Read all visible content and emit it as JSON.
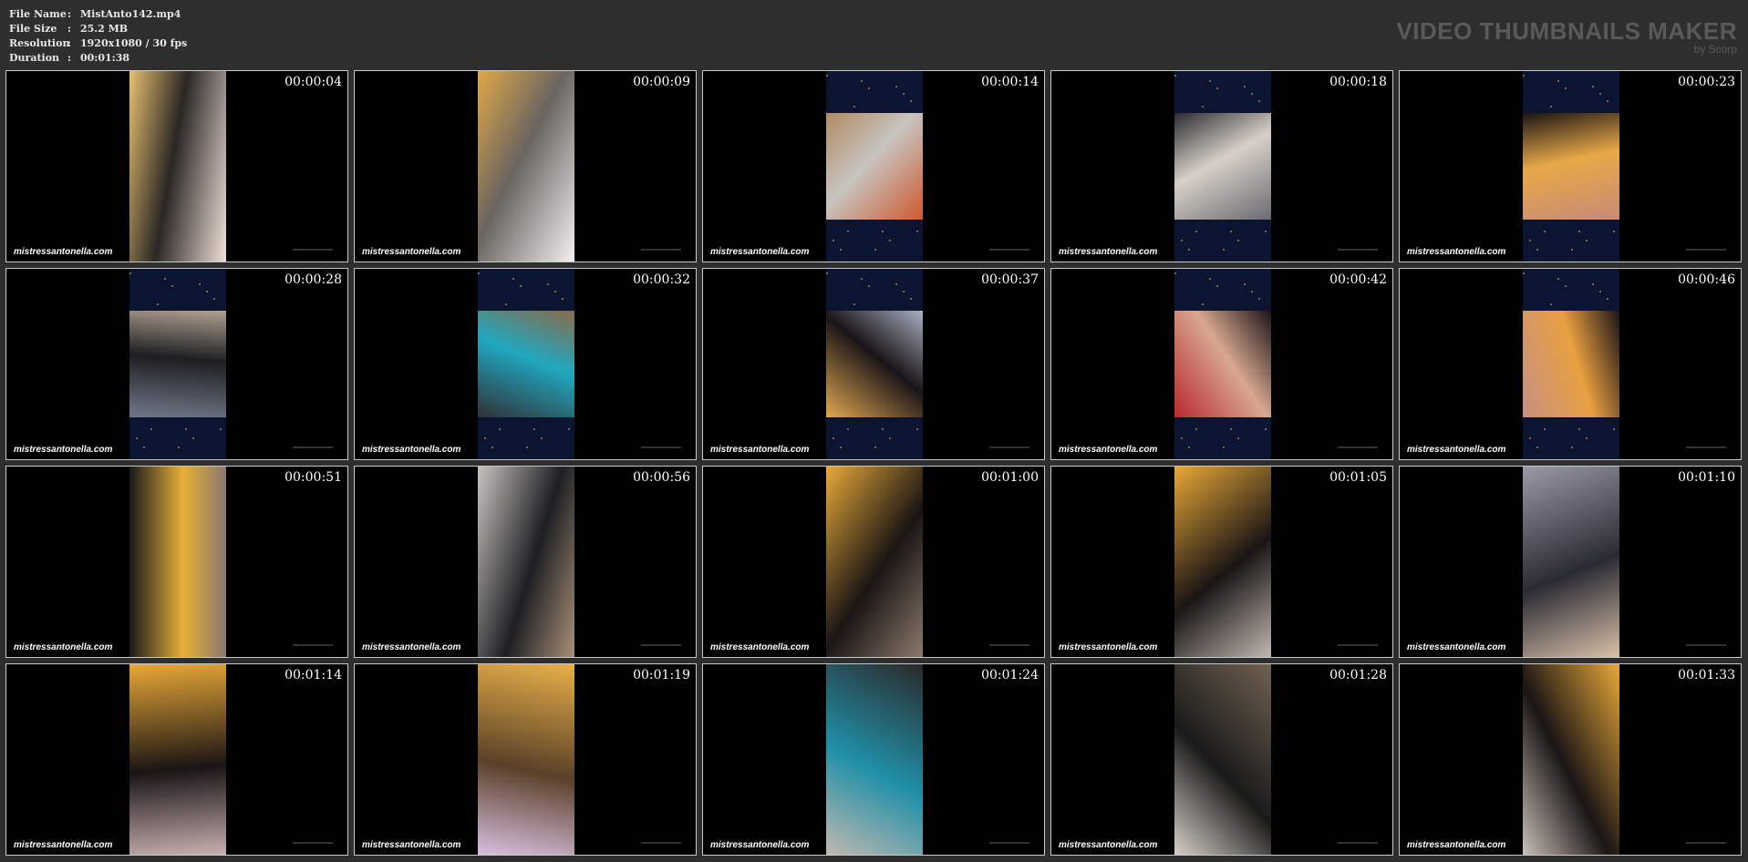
{
  "file_info": [
    {
      "key": "File Name",
      "sep": ":",
      "value": "MistAnto142.mp4"
    },
    {
      "key": "File Size",
      "sep": ":",
      "value": "25.2 MB"
    },
    {
      "key": "Resolution",
      "sep": ":",
      "value": "1920x1080 / 30 fps"
    },
    {
      "key": "Duration",
      "sep": ":",
      "value": "00:01:38"
    }
  ],
  "brand": {
    "title": "VIDEO THUMBNAILS MAKER",
    "subtitle": "by Scorp"
  },
  "colors": {
    "background": "#2e2e2e",
    "thumb_border": "#c8c8c8",
    "brand_text": "#5a5a5a",
    "header_text": "#e8e8e8"
  },
  "thumbnails": [
    {
      "time": "00:00:04",
      "watermark": "mistressantonella.com",
      "palette": [
        "#e8c070",
        "#2a2624",
        "#f0e0d8"
      ],
      "starry": false
    },
    {
      "time": "00:00:09",
      "watermark": "mistressantonella.com",
      "palette": [
        "#e0a848",
        "#6a6460",
        "#f4f0f0"
      ],
      "starry": false
    },
    {
      "time": "00:00:14",
      "watermark": "mistressantonella.com",
      "palette": [
        "#b08a62",
        "#c8c4c0",
        "#d05830"
      ],
      "starry": true
    },
    {
      "time": "00:00:18",
      "watermark": "mistressantonella.com",
      "palette": [
        "#2a2a30",
        "#d8d0c8",
        "#6a6a70"
      ],
      "starry": true
    },
    {
      "time": "00:00:23",
      "watermark": "mistressantonella.com",
      "palette": [
        "#1a1414",
        "#e8a848",
        "#c88a78"
      ],
      "starry": true
    },
    {
      "time": "00:00:28",
      "watermark": "mistressantonella.com",
      "palette": [
        "#b0a090",
        "#1e1e22",
        "#707888"
      ],
      "starry": true
    },
    {
      "time": "00:00:32",
      "watermark": "mistressantonella.com",
      "palette": [
        "#8a6a4a",
        "#20a8c0",
        "#303034"
      ],
      "starry": true
    },
    {
      "time": "00:00:37",
      "watermark": "mistressantonella.com",
      "palette": [
        "#a8b0c0",
        "#1a1418",
        "#e0a850"
      ],
      "starry": true
    },
    {
      "time": "00:00:42",
      "watermark": "mistressantonella.com",
      "palette": [
        "#1a1418",
        "#d8a890",
        "#b82830"
      ],
      "starry": true
    },
    {
      "time": "00:00:46",
      "watermark": "mistressantonella.com",
      "palette": [
        "#1a1418",
        "#e8a040",
        "#c89080"
      ],
      "starry": true
    },
    {
      "time": "00:00:51",
      "watermark": "mistressantonella.com",
      "palette": [
        "#8a7870",
        "#e8b038",
        "#181818"
      ],
      "starry": false
    },
    {
      "time": "00:00:56",
      "watermark": "mistressantonella.com",
      "palette": [
        "#a89078",
        "#1e1e22",
        "#c8c4c0"
      ],
      "starry": false
    },
    {
      "time": "00:01:00",
      "watermark": "mistressantonella.com",
      "palette": [
        "#8a7a6a",
        "#1a1414",
        "#e8a838"
      ],
      "starry": false
    },
    {
      "time": "00:01:05",
      "watermark": "mistressantonella.com",
      "palette": [
        "#c0b8b0",
        "#1a1414",
        "#e8a838"
      ],
      "starry": false
    },
    {
      "time": "00:01:10",
      "watermark": "mistressantonella.com",
      "palette": [
        "#d8c0a8",
        "#2a2a34",
        "#9a9aa8"
      ],
      "starry": false
    },
    {
      "time": "00:01:14",
      "watermark": "mistressantonella.com",
      "palette": [
        "#c8b0b0",
        "#1a1414",
        "#e8a838"
      ],
      "starry": false
    },
    {
      "time": "00:01:19",
      "watermark": "mistressantonella.com",
      "palette": [
        "#d8c0e0",
        "#5a4028",
        "#e8b048"
      ],
      "starry": false
    },
    {
      "time": "00:01:24",
      "watermark": "mistressantonella.com",
      "palette": [
        "#c0b8b0",
        "#2090a8",
        "#2a2a2a"
      ],
      "starry": false
    },
    {
      "time": "00:01:28",
      "watermark": "mistressantonella.com",
      "palette": [
        "#d8d0c8",
        "#1a1a1a",
        "#706050"
      ],
      "starry": false
    },
    {
      "time": "00:01:33",
      "watermark": "mistressantonella.com",
      "palette": [
        "#c8c0b8",
        "#1a1414",
        "#e8a838"
      ],
      "starry": false
    }
  ]
}
